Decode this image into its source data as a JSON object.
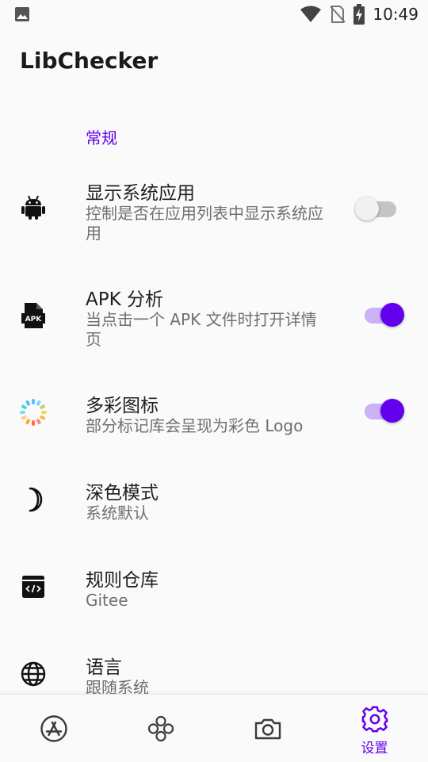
{
  "status_bar": {
    "time": "10:49",
    "icons": [
      "image-icon",
      "wifi-icon",
      "sim-off-icon",
      "battery-charging-icon"
    ]
  },
  "app": {
    "title": "LibChecker"
  },
  "settings": {
    "section_general": "常规",
    "items": [
      {
        "icon": "android-icon",
        "title": "显示系统应用",
        "summary": "控制是否在应用列表中显示系统应用",
        "switch_on": false
      },
      {
        "icon": "apk-icon",
        "title": "APK 分析",
        "summary": "当点击一个 APK 文件时打开详情页",
        "switch_on": true
      },
      {
        "icon": "colorful-ring-icon",
        "title": "多彩图标",
        "summary": "部分标记库会呈现为彩色 Logo",
        "switch_on": true
      },
      {
        "icon": "moon-icon",
        "title": "深色模式",
        "summary": "系统默认"
      },
      {
        "icon": "code-box-icon",
        "title": "规则仓库",
        "summary": "Gitee"
      },
      {
        "icon": "globe-icon",
        "title": "语言",
        "summary": "跟随系统"
      }
    ]
  },
  "bottom_nav": {
    "items": [
      {
        "icon": "app-store-icon",
        "label": ""
      },
      {
        "icon": "clover-icon",
        "label": ""
      },
      {
        "icon": "camera-icon",
        "label": ""
      },
      {
        "icon": "gear-icon",
        "label": "设置",
        "selected": true
      }
    ]
  },
  "colors": {
    "accent": "#6200ee",
    "switch_track_on": "#cbb1f6",
    "switch_off": "#c4c4c4"
  }
}
